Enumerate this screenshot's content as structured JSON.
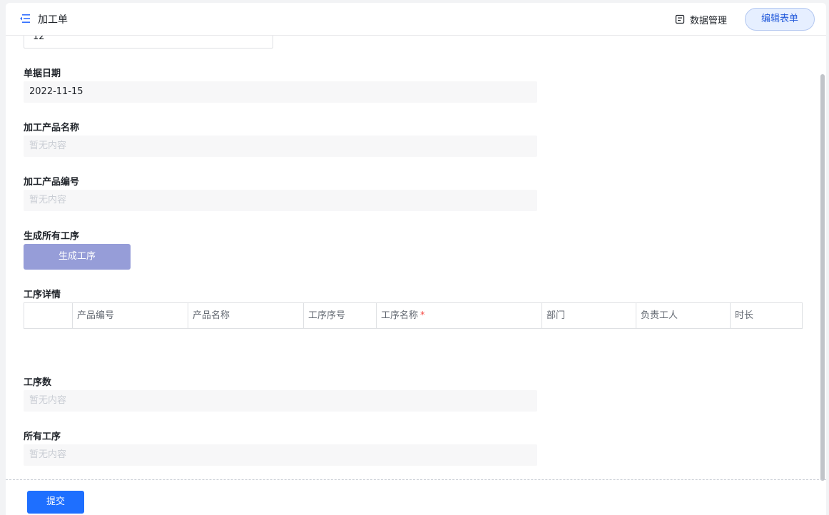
{
  "header": {
    "title": "加工单",
    "data_management": "数据管理",
    "edit_form": "编辑表单"
  },
  "form": {
    "top_value": "12",
    "doc_date": {
      "label": "单据日期",
      "value": "2022-11-15"
    },
    "product_name": {
      "label": "加工产品名称",
      "placeholder": "暂无内容"
    },
    "product_code": {
      "label": "加工产品编号",
      "placeholder": "暂无内容"
    },
    "generate": {
      "label": "生成所有工序",
      "button": "生成工序"
    },
    "process_details": {
      "label": "工序详情",
      "columns": [
        "",
        "产品编号",
        "产品名称",
        "工序序号",
        "工序名称",
        "部门",
        "负责工人",
        "时长"
      ],
      "required_marker": "*"
    },
    "process_count": {
      "label": "工序数",
      "placeholder": "暂无内容"
    },
    "all_processes": {
      "label": "所有工序",
      "placeholder": "暂无内容"
    }
  },
  "footer": {
    "submit": "提交"
  },
  "colors": {
    "accent": "#1e6fff",
    "generate_button": "#969dd8",
    "required": "#f54a45"
  }
}
